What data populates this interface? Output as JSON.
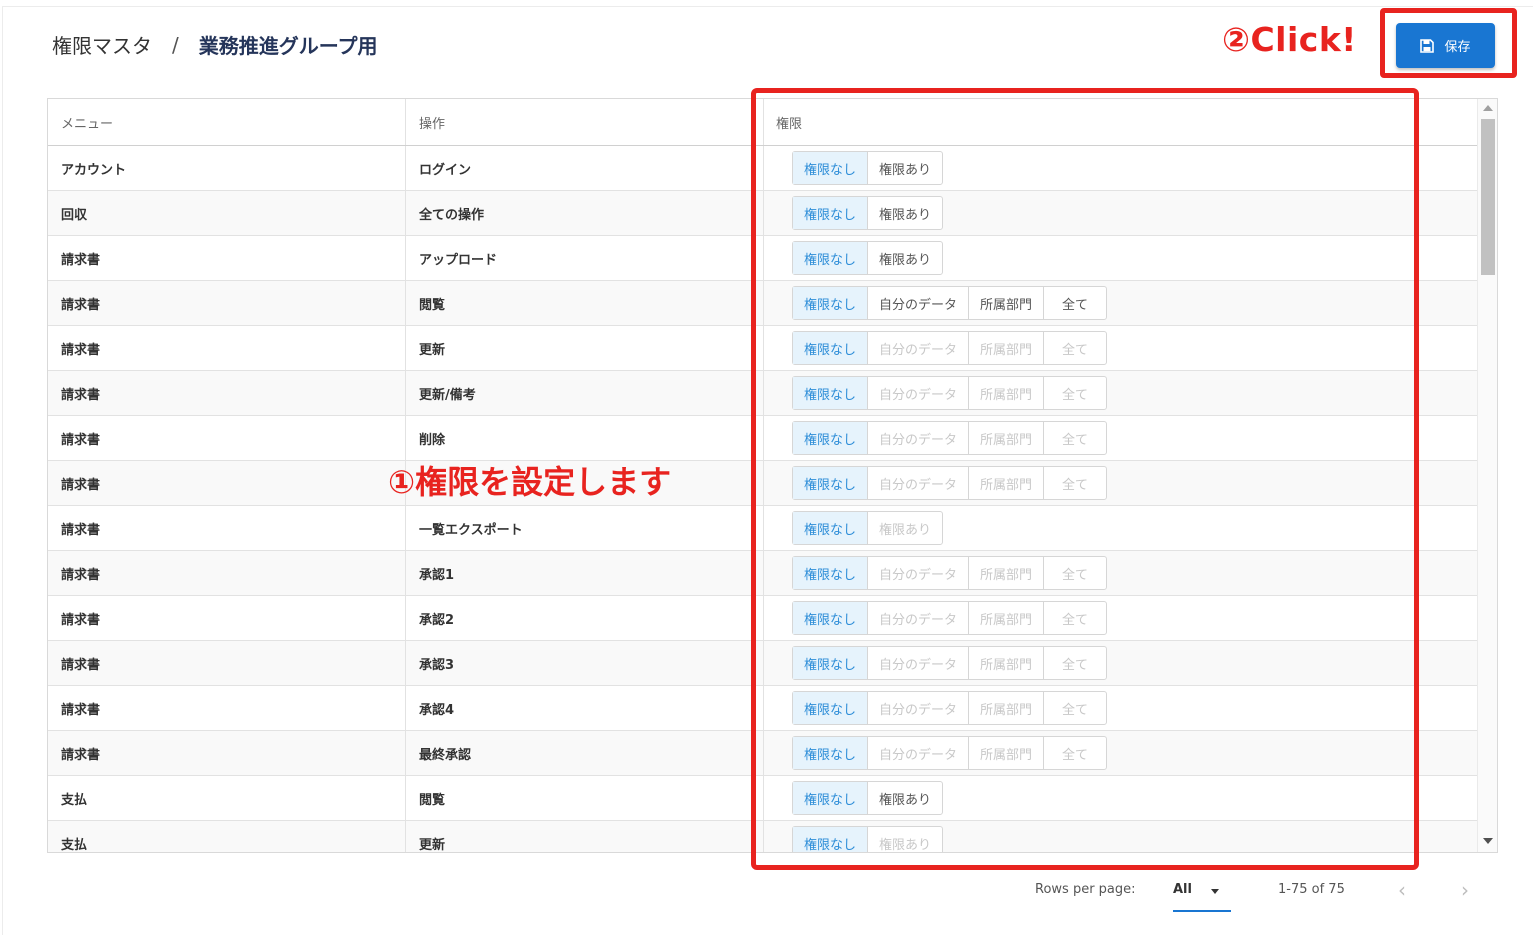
{
  "breadcrumb": {
    "root": "権限マスタ",
    "separator": "/",
    "current": "業務推進グループ用"
  },
  "annotations": {
    "click": "②Click!",
    "set_permissions": "①権限を設定します"
  },
  "toolbar": {
    "save_label": "保存"
  },
  "table": {
    "headers": [
      "メニュー",
      "操作",
      "権限"
    ],
    "rows": [
      {
        "menu": "アカウント",
        "op": "ログイン",
        "options": [
          "権限なし",
          "権限あり"
        ],
        "disabled": false
      },
      {
        "menu": "回収",
        "op": "全ての操作",
        "options": [
          "権限なし",
          "権限あり"
        ],
        "disabled": false
      },
      {
        "menu": "請求書",
        "op": "アップロード",
        "options": [
          "権限なし",
          "権限あり"
        ],
        "disabled": false
      },
      {
        "menu": "請求書",
        "op": "閲覧",
        "options": [
          "権限なし",
          "自分のデータ",
          "所属部門",
          "全て"
        ],
        "disabled": false
      },
      {
        "menu": "請求書",
        "op": "更新",
        "options": [
          "権限なし",
          "自分のデータ",
          "所属部門",
          "全て"
        ],
        "disabled": true
      },
      {
        "menu": "請求書",
        "op": "更新/備考",
        "options": [
          "権限なし",
          "自分のデータ",
          "所属部門",
          "全て"
        ],
        "disabled": true
      },
      {
        "menu": "請求書",
        "op": "削除",
        "options": [
          "権限なし",
          "自分のデータ",
          "所属部門",
          "全て"
        ],
        "disabled": true
      },
      {
        "menu": "請求書",
        "op": "",
        "options": [
          "権限なし",
          "自分のデータ",
          "所属部門",
          "全て"
        ],
        "disabled": true
      },
      {
        "menu": "請求書",
        "op": "一覧エクスポート",
        "options": [
          "権限なし",
          "権限あり"
        ],
        "disabled": true
      },
      {
        "menu": "請求書",
        "op": "承認1",
        "options": [
          "権限なし",
          "自分のデータ",
          "所属部門",
          "全て"
        ],
        "disabled": true
      },
      {
        "menu": "請求書",
        "op": "承認2",
        "options": [
          "権限なし",
          "自分のデータ",
          "所属部門",
          "全て"
        ],
        "disabled": true
      },
      {
        "menu": "請求書",
        "op": "承認3",
        "options": [
          "権限なし",
          "自分のデータ",
          "所属部門",
          "全て"
        ],
        "disabled": true
      },
      {
        "menu": "請求書",
        "op": "承認4",
        "options": [
          "権限なし",
          "自分のデータ",
          "所属部門",
          "全て"
        ],
        "disabled": true
      },
      {
        "menu": "請求書",
        "op": "最終承認",
        "options": [
          "権限なし",
          "自分のデータ",
          "所属部門",
          "全て"
        ],
        "disabled": true
      },
      {
        "menu": "支払",
        "op": "閲覧",
        "options": [
          "権限なし",
          "権限あり"
        ],
        "disabled": false
      },
      {
        "menu": "支払",
        "op": "更新",
        "options": [
          "権限なし",
          "権限あり"
        ],
        "disabled": true
      }
    ]
  },
  "footer": {
    "rows_per_page_label": "Rows per page:",
    "rows_per_page_value": "All",
    "range": "1-75 of 75",
    "prev": "‹",
    "next": "›"
  },
  "colors": {
    "accent": "#1976d2",
    "annotation": "#e8231f",
    "active_bg": "#e6f3fc",
    "active_text": "#2d8dd8"
  }
}
